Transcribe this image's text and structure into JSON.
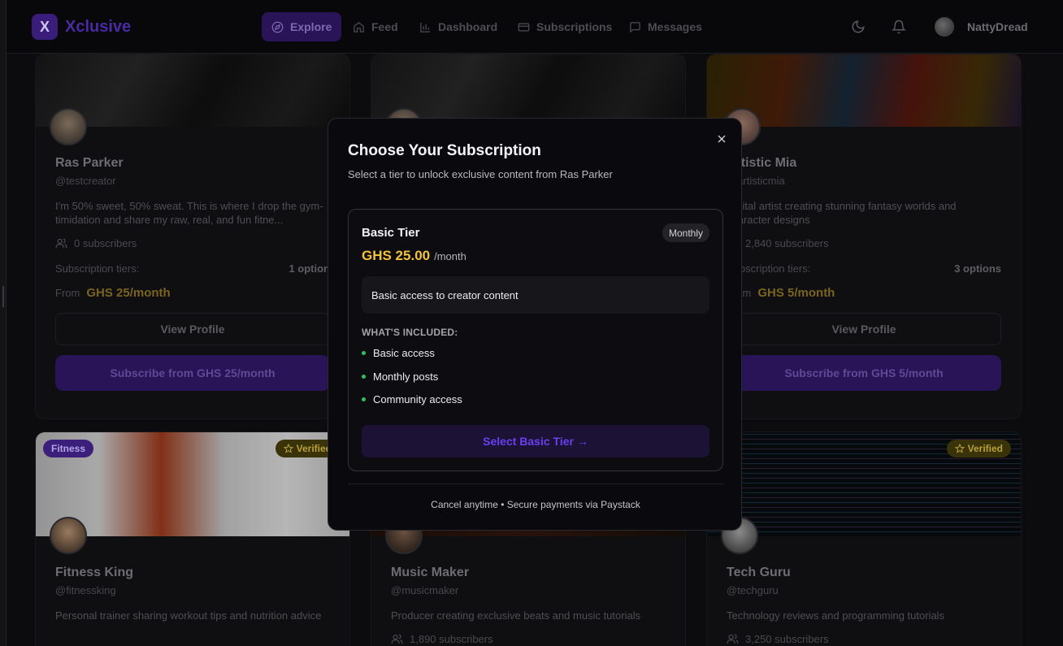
{
  "nav": {
    "logo_letter": "X",
    "logo_text": "Xclusive",
    "items": [
      {
        "label": "Explore",
        "icon": "compass-icon",
        "active": true
      },
      {
        "label": "Feed",
        "icon": "home-icon",
        "active": false
      },
      {
        "label": "Dashboard",
        "icon": "bar-chart-icon",
        "active": false
      },
      {
        "label": "Subscriptions",
        "icon": "credit-card-icon",
        "active": false
      },
      {
        "label": "Messages",
        "icon": "message-square-icon",
        "active": false
      }
    ],
    "user_name": "NattyDread"
  },
  "cards": [
    {
      "name": "Ras Parker",
      "handle": "@testcreator",
      "bio": "I'm 50% sweet, 50% sweat. This is where I drop the gym-timidation and share my raw, real, and fun fitne...",
      "subscribers": "0 subscribers",
      "tiers_label": "Subscription tiers:",
      "tiers_value": "1 option",
      "from_label": "From",
      "from_price": "GHS 25/month",
      "view_label": "View Profile",
      "subscribe_label": "Subscribe from GHS 25/month"
    },
    {
      "name": "",
      "handle": "",
      "bio": "",
      "subscribers": "",
      "tiers_label": "",
      "tiers_value": "",
      "from_label": "",
      "from_price": "",
      "view_label": "",
      "subscribe_label": ""
    },
    {
      "name": "Artistic Mia",
      "handle": "@artisticmia",
      "bio": "Digital artist creating stunning fantasy worlds and character designs",
      "subscribers": "2,840 subscribers",
      "tiers_label": "Subscription tiers:",
      "tiers_value": "3 options",
      "from_label": "From",
      "from_price": "GHS 5/month",
      "view_label": "View Profile",
      "subscribe_label": "Subscribe from GHS 5/month"
    },
    {
      "name": "Fitness King",
      "handle": "@fitnessking",
      "bio": "Personal trainer sharing workout tips and nutrition advice",
      "subscribers": "",
      "category": "Fitness",
      "verified": "Verified"
    },
    {
      "name": "Music Maker",
      "handle": "@musicmaker",
      "bio": "Producer creating exclusive beats and music tutorials",
      "subscribers": "1,890 subscribers"
    },
    {
      "name": "Tech Guru",
      "handle": "@techguru",
      "bio": "Technology reviews and programming tutorials",
      "subscribers": "3,250 subscribers",
      "verified": "Verified"
    }
  ],
  "modal": {
    "title": "Choose Your Subscription",
    "subtitle": "Select a tier to unlock exclusive content from Ras Parker",
    "tier": {
      "name": "Basic Tier",
      "badge": "Monthly",
      "price": "GHS 25.00",
      "period": "/month",
      "description": "Basic access to creator content",
      "included_heading": "WHAT'S INCLUDED:",
      "features": [
        "Basic access",
        "Monthly posts",
        "Community access"
      ],
      "select_label": "Select Basic Tier →"
    },
    "footer": "Cancel anytime • Secure payments via Paystack"
  },
  "colors": {
    "accent": "#6a3ff0",
    "price": "#f2c23a",
    "feature_dot": "#2fbf5f"
  }
}
